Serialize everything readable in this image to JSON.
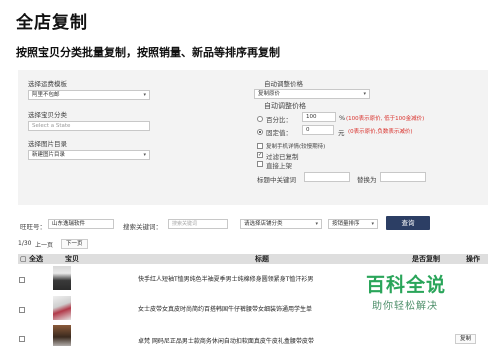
{
  "header": {
    "title": "全店复制",
    "subtitle": "按照宝贝分类批量复制，按照销量、新品等排序再复制"
  },
  "form": {
    "shipping_template_label": "选择运费模板",
    "shipping_template_value": "阿里不包邮",
    "product_category_label": "选择宝贝分类",
    "product_category_placeholder": "Select a State",
    "image_dir_label": "选择图片目录",
    "image_dir_value": "新建图片目录",
    "auto_price_label": "自动调整价格",
    "auto_price_value": "复制原价",
    "auto_price_sub_label": "自动调整价格",
    "percent_label": "百分比：",
    "percent_value": "100",
    "percent_unit": "%",
    "percent_hint": "(100表示原价, 低于100金减价)",
    "fixed_label": "固定值：",
    "fixed_value": "0",
    "fixed_unit": "元",
    "fixed_hint": "(0表示原价,负数表示减价)",
    "mobile_detail_label": "复制手机详情(较慢期待)",
    "filter_copied_label": "过滤已复制",
    "direct_listing_label": "直接上架",
    "keyword_label": "标题中关键词",
    "replace_label": "替换为"
  },
  "filters": {
    "wangwang_label": "旺旺号：",
    "wangwang_value": "山东逸瑞软件",
    "search_label": "搜索关键词：",
    "search_placeholder": "搜索关键词",
    "shop_category_value": "请选择店铺分类",
    "sort_value": "按销量排序",
    "query_button": "查询"
  },
  "pager": {
    "info": "1/30",
    "prev_label": "上一页",
    "next_label": "下一页"
  },
  "table": {
    "headers": {
      "select_all": "全选",
      "product": "宝贝",
      "title": "标题",
      "copied": "是否复制",
      "action": "操作"
    },
    "rows": [
      {
        "title": "快手红人短袖T恤男纯色半袖夏季男士纯棉修身圆领紧身T恤汗衫男",
        "action": ""
      },
      {
        "title": "女士皮带女真皮时尚简约百搭韩国牛仔裤腰带女细装饰通用学生单",
        "action": ""
      },
      {
        "title": "卓梵  网码尼正品男士款商务休闲自动扣软面真皮牛皮礼盒腰带皮带",
        "action": "复制"
      }
    ]
  },
  "watermark": {
    "main": "百科全说",
    "sub": "助你轻松解决"
  },
  "colors": {
    "query_button": "#2c3e64",
    "hint_red": "#d9302b",
    "watermark_green": "#2aa55a"
  }
}
